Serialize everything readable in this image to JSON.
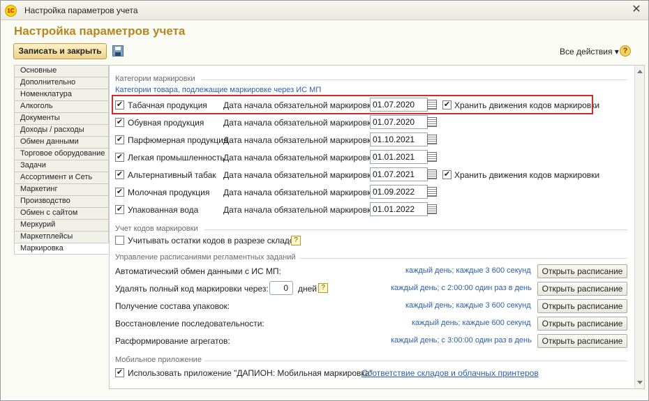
{
  "window": {
    "title": "Настройка параметров учета",
    "logo_text": "1С"
  },
  "header": {
    "title": "Настройка параметров учета",
    "save_close_label": "Записать и закрыть",
    "all_actions_label": "Все действия ▾",
    "help_label": "?"
  },
  "nav": {
    "items": [
      {
        "label": "Основные"
      },
      {
        "label": "Дополнительно"
      },
      {
        "label": "Номенклатура"
      },
      {
        "label": "Алкоголь"
      },
      {
        "label": "Документы"
      },
      {
        "label": "Доходы / расходы"
      },
      {
        "label": "Обмен данными"
      },
      {
        "label": "Торговое оборудование"
      },
      {
        "label": "Задачи"
      },
      {
        "label": "Ассортимент и Сеть"
      },
      {
        "label": "Маркетинг"
      },
      {
        "label": "Производство"
      },
      {
        "label": "Обмен с сайтом"
      },
      {
        "label": "Меркурий"
      },
      {
        "label": "Маркетплейсы"
      },
      {
        "label": "Маркировка",
        "active": true
      }
    ]
  },
  "marking": {
    "group_title": "Категории маркировки",
    "subtitle": "Категории товара, подлежащие маркировке через ИС МП",
    "date_label": "Дата начала обязательной маркировки:",
    "store_label": "Хранить движения кодов маркировки",
    "categories": [
      {
        "label": "Табачная продукция",
        "checked": true,
        "date": "01.07.2020",
        "store": true
      },
      {
        "label": "Обувная продукция",
        "checked": true,
        "date": "01.07.2020"
      },
      {
        "label": "Парфюмерная продукция",
        "checked": true,
        "date": "01.10.2021"
      },
      {
        "label": "Легкая промышленность",
        "checked": true,
        "date": "01.01.2021"
      },
      {
        "label": "Альтернативный табак",
        "checked": true,
        "date": "01.07.2021",
        "store": true
      },
      {
        "label": "Молочная продукция",
        "checked": true,
        "date": "01.09.2022"
      },
      {
        "label": "Упакованная вода",
        "checked": true,
        "date": "01.01.2022"
      }
    ]
  },
  "codes": {
    "group_title": "Учет кодов маркировки",
    "stock_label": "Учитывать остатки кодов в разрезе складов",
    "stock_checked": false
  },
  "schedules": {
    "group_title": "Управление расписаниями регламентных заданий",
    "open_label": "Открыть расписание",
    "days_label": "дней",
    "days_value": "0",
    "rows": [
      {
        "label": "Автоматический обмен данными с ИС МП:",
        "schedule": "каждый день; каждые 3 600 секунд"
      },
      {
        "label": "Удалять полный код маркировки через:",
        "schedule": "каждый день; с 2:00:00 один раз в день"
      },
      {
        "label": "Получение состава упаковок:",
        "schedule": "каждый день; каждые 3 600 секунд"
      },
      {
        "label": "Восстановление последовательности:",
        "schedule": "каждый день; каждые 600 секунд"
      },
      {
        "label": "Расформирование агрегатов:",
        "schedule": "каждый день; с 3:00:00 один раз в день"
      }
    ]
  },
  "mobile": {
    "group_title": "Мобильное приложение",
    "use_label": "Использовать приложение \"ДАПИОН: Мобильная маркировка\"",
    "use_checked": true,
    "link_label": "Соответствие складов и облачных принтеров"
  },
  "colors": {
    "title_accent": "#b5871c",
    "link": "#2a5db0",
    "highlight": "#d12a2a"
  }
}
